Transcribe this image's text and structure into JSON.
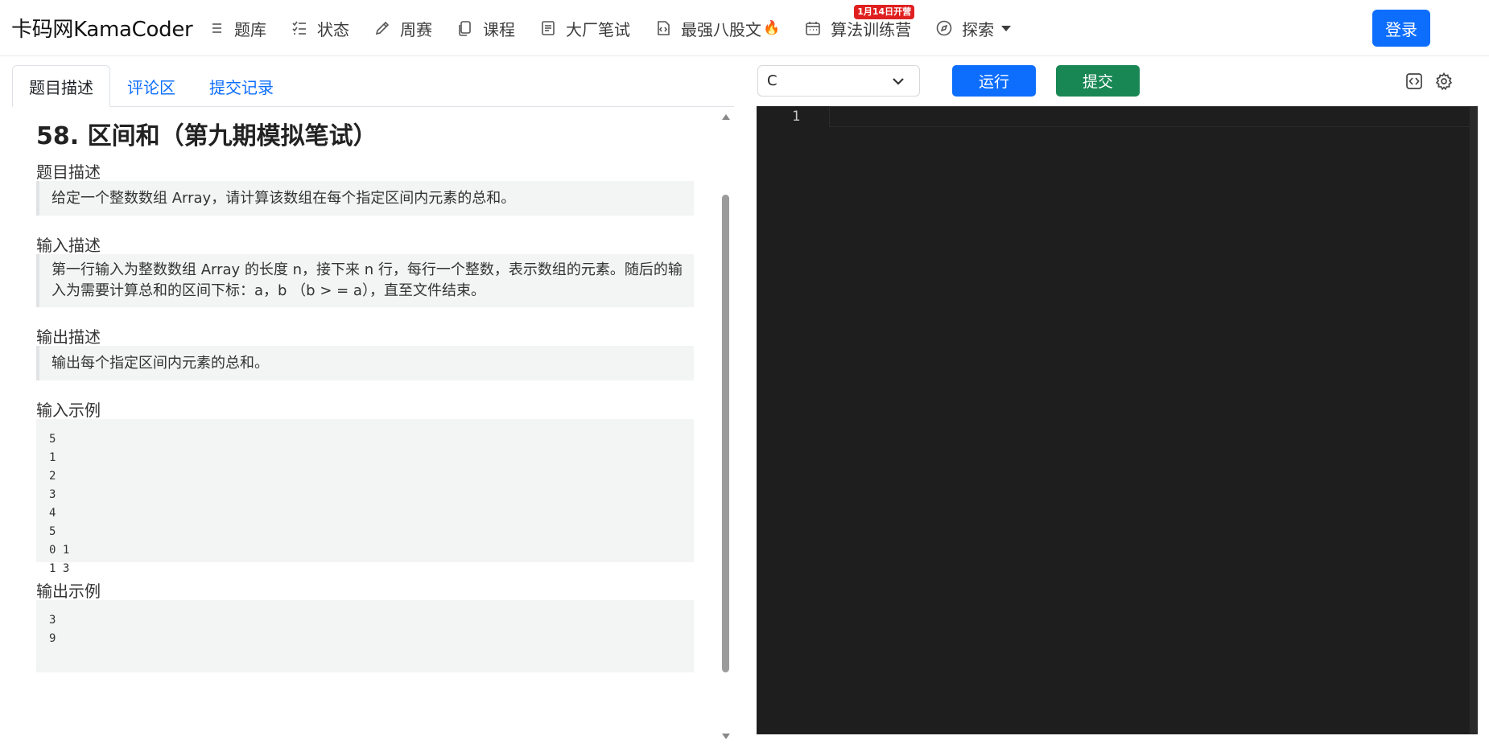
{
  "navbar": {
    "brand": "卡码网KamaCoder",
    "items": [
      {
        "label": "题库",
        "icon": "list-icon"
      },
      {
        "label": "状态",
        "icon": "checklist-icon"
      },
      {
        "label": "周赛",
        "icon": "pencil-icon"
      },
      {
        "label": "课程",
        "icon": "copy-icon"
      },
      {
        "label": "大厂笔试",
        "icon": "document-icon"
      },
      {
        "label": "最强八股文",
        "icon": "code-file-icon",
        "extra": "🔥"
      },
      {
        "label": "算法训练营",
        "icon": "calendar-icon",
        "badge": "1月14日开营"
      },
      {
        "label": "探索",
        "icon": "compass-icon"
      }
    ],
    "login_label": "登录"
  },
  "tabs": [
    {
      "label": "题目描述",
      "active": true
    },
    {
      "label": "评论区",
      "active": false
    },
    {
      "label": "提交记录",
      "active": false
    }
  ],
  "problem": {
    "title": "58. 区间和（第九期模拟笔试）",
    "sections": {
      "description_heading": "题目描述",
      "description": "给定一个整数数组 Array，请计算该数组在每个指定区间内元素的总和。",
      "input_heading": "输入描述",
      "input": "第一行输入为整数数组 Array 的长度 n，接下来 n 行，每行一个整数，表示数组的元素。随后的输入为需要计算总和的区间下标：a，b （b > = a），直至文件结束。",
      "output_heading": "输出描述",
      "output": "输出每个指定区间内元素的总和。",
      "sample_input_heading": "输入示例",
      "sample_input": [
        "5",
        "1",
        "2",
        "3",
        "4",
        "5",
        "0 1",
        "1 3"
      ],
      "sample_output_heading": "输出示例",
      "sample_output": [
        "3",
        "9"
      ]
    }
  },
  "editor": {
    "language": "C",
    "run_label": "运行",
    "submit_label": "提交",
    "line_numbers": [
      "1"
    ],
    "background": "#1e1e1e"
  },
  "colors": {
    "primary": "#0d6efd",
    "success": "#198754",
    "badge": "#e02020"
  }
}
